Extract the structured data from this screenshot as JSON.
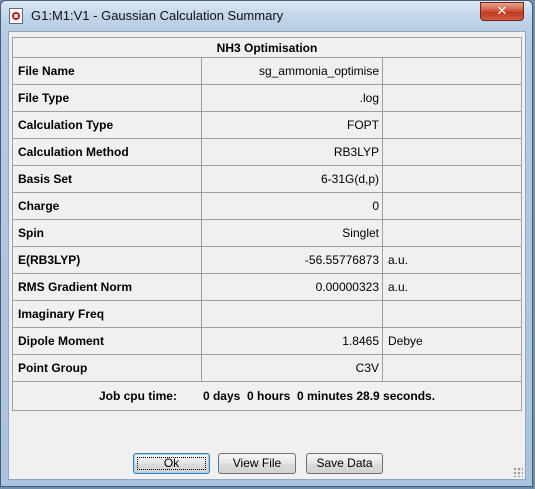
{
  "window": {
    "title": "G1:M1:V1 - Gaussian Calculation Summary",
    "close_label": "✕"
  },
  "summary": {
    "heading": "NH3 Optimisation",
    "rows": [
      {
        "label": "File Name",
        "value": "sg_ammonia_optimise",
        "unit": ""
      },
      {
        "label": "File Type",
        "value": ".log",
        "unit": ""
      },
      {
        "label": "Calculation Type",
        "value": "FOPT",
        "unit": ""
      },
      {
        "label": "Calculation Method",
        "value": "RB3LYP",
        "unit": ""
      },
      {
        "label": "Basis Set",
        "value": "6-31G(d,p)",
        "unit": ""
      },
      {
        "label": "Charge",
        "value": "0",
        "unit": ""
      },
      {
        "label": "Spin",
        "value": "Singlet",
        "unit": ""
      },
      {
        "label": "E(RB3LYP)",
        "value": "-56.55776873",
        "unit": "a.u."
      },
      {
        "label": "RMS Gradient Norm",
        "value": "0.00000323",
        "unit": "a.u."
      },
      {
        "label": "Imaginary Freq",
        "value": "",
        "unit": ""
      },
      {
        "label": "Dipole Moment",
        "value": "1.8465",
        "unit": "Debye"
      },
      {
        "label": "Point Group",
        "value": "C3V",
        "unit": ""
      }
    ],
    "cpu_label": "Job cpu time:",
    "cpu_value": "0 days  0 hours  0 minutes 28.9 seconds."
  },
  "buttons": {
    "ok": "Ok",
    "view_file": "View File",
    "save_data": "Save Data"
  },
  "icons": {
    "app": "gaussview-document-icon",
    "close": "close-icon",
    "grip": "resize-grip-icon"
  }
}
